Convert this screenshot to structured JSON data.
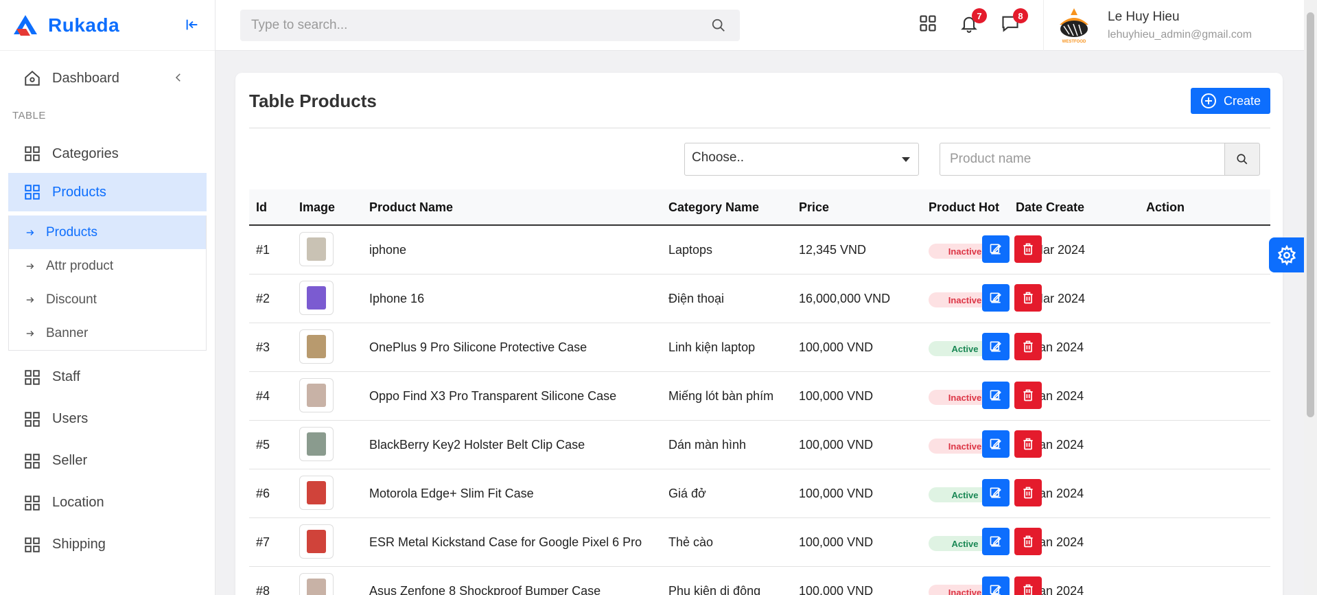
{
  "brand": {
    "name": "Rukada"
  },
  "sidebar": {
    "dashboard": "Dashboard",
    "section_label": "TABLE",
    "items_top": [
      {
        "label": "Categories"
      },
      {
        "label": "Products"
      }
    ],
    "submenu": [
      {
        "label": "Products"
      },
      {
        "label": "Attr product"
      },
      {
        "label": "Discount"
      },
      {
        "label": "Banner"
      }
    ],
    "items_bottom": [
      {
        "label": "Staff"
      },
      {
        "label": "Users"
      },
      {
        "label": "Seller"
      },
      {
        "label": "Location"
      },
      {
        "label": "Shipping"
      }
    ]
  },
  "header": {
    "search_placeholder": "Type to search...",
    "notifications_count": "7",
    "messages_count": "8",
    "user_name": "Le Huy Hieu",
    "user_email": "lehuyhieu_admin@gmail.com",
    "avatar_text": "WESTFOOD"
  },
  "page": {
    "title": "Table Products",
    "create_label": "Create",
    "category_select": "Choose..",
    "product_name_placeholder": "Product name"
  },
  "table": {
    "headers": [
      "Id",
      "Image",
      "Product Name",
      "Category Name",
      "Price",
      "Product Hot",
      "Date Create",
      "Action"
    ],
    "rows": [
      {
        "id": "#1",
        "name": "iphone",
        "category": "Laptops",
        "price": "12,345 VND",
        "status": "Inactive",
        "date": "21 Mar 2024",
        "thumb_color": "#c9c2b4"
      },
      {
        "id": "#2",
        "name": "Iphone 16",
        "category": "Điện thoại",
        "price": "16,000,000 VND",
        "status": "Inactive",
        "date": "07 Mar 2024",
        "thumb_color": "#7b5bd1"
      },
      {
        "id": "#3",
        "name": "OnePlus 9 Pro Silicone Protective Case",
        "category": "Linh kiện laptop",
        "price": "100,000 VND",
        "status": "Active",
        "date": "07 Jan 2024",
        "thumb_color": "#b89a6e"
      },
      {
        "id": "#4",
        "name": "Oppo Find X3 Pro Transparent Silicone Case",
        "category": "Miếng lót bàn phím",
        "price": "100,000 VND",
        "status": "Inactive",
        "date": "07 Jan 2024",
        "thumb_color": "#c8b2a6"
      },
      {
        "id": "#5",
        "name": "BlackBerry Key2 Holster Belt Clip Case",
        "category": "Dán màn hình",
        "price": "100,000 VND",
        "status": "Inactive",
        "date": "07 Jan 2024",
        "thumb_color": "#8a9b8e"
      },
      {
        "id": "#6",
        "name": "Motorola Edge+ Slim Fit Case",
        "category": "Giá đở",
        "price": "100,000 VND",
        "status": "Active",
        "date": "07 Jan 2024",
        "thumb_color": "#d0433a"
      },
      {
        "id": "#7",
        "name": "ESR Metal Kickstand Case for Google Pixel 6 Pro",
        "category": "Thẻ cào",
        "price": "100,000 VND",
        "status": "Active",
        "date": "07 Jan 2024",
        "thumb_color": "#d0433a"
      },
      {
        "id": "#8",
        "name": "Asus Zenfone 8 Shockproof Bumper Case",
        "category": "Phụ kiện di động",
        "price": "100,000 VND",
        "status": "Inactive",
        "date": "07 Jan 2024",
        "thumb_color": "#c8b2a6"
      }
    ]
  }
}
